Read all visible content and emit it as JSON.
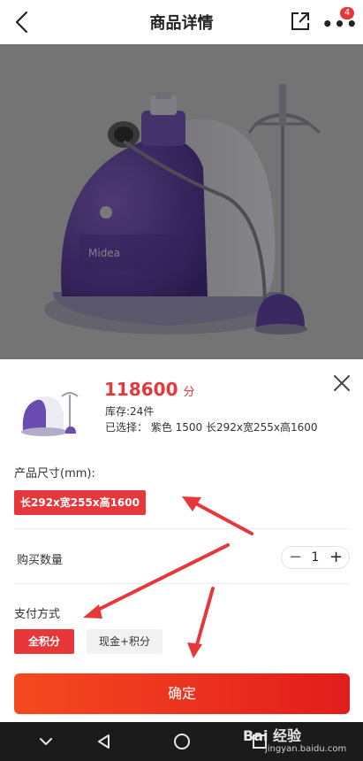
{
  "header": {
    "title": "商品详情",
    "badge_count": "4",
    "icons": {
      "back": "chevron-left-icon",
      "share": "share-icon",
      "more": "more-icon"
    }
  },
  "product": {
    "image_brand": "Midea",
    "price": "118600",
    "price_unit": "分",
    "stock": "库存:24件",
    "selected": "已选择： 紫色 1500 长292x宽255x高1600"
  },
  "size_section": {
    "label": "产品尺寸(mm):",
    "options": [
      "长292x宽255x高1600"
    ],
    "selected_index": 0
  },
  "quantity": {
    "label": "购买数量",
    "value": "1",
    "minus": "−",
    "plus": "+"
  },
  "payment": {
    "label": "支付方式",
    "options": [
      "全积分",
      "现金+积分"
    ],
    "selected_index": 0
  },
  "confirm_label": "确定",
  "watermark": {
    "main": "Bai 经验",
    "sub": "jingyan.baidu.com"
  },
  "colors": {
    "accent": "#e8373a",
    "product_purple": "#6a4bb0",
    "navbar": "#1b1b1b"
  }
}
